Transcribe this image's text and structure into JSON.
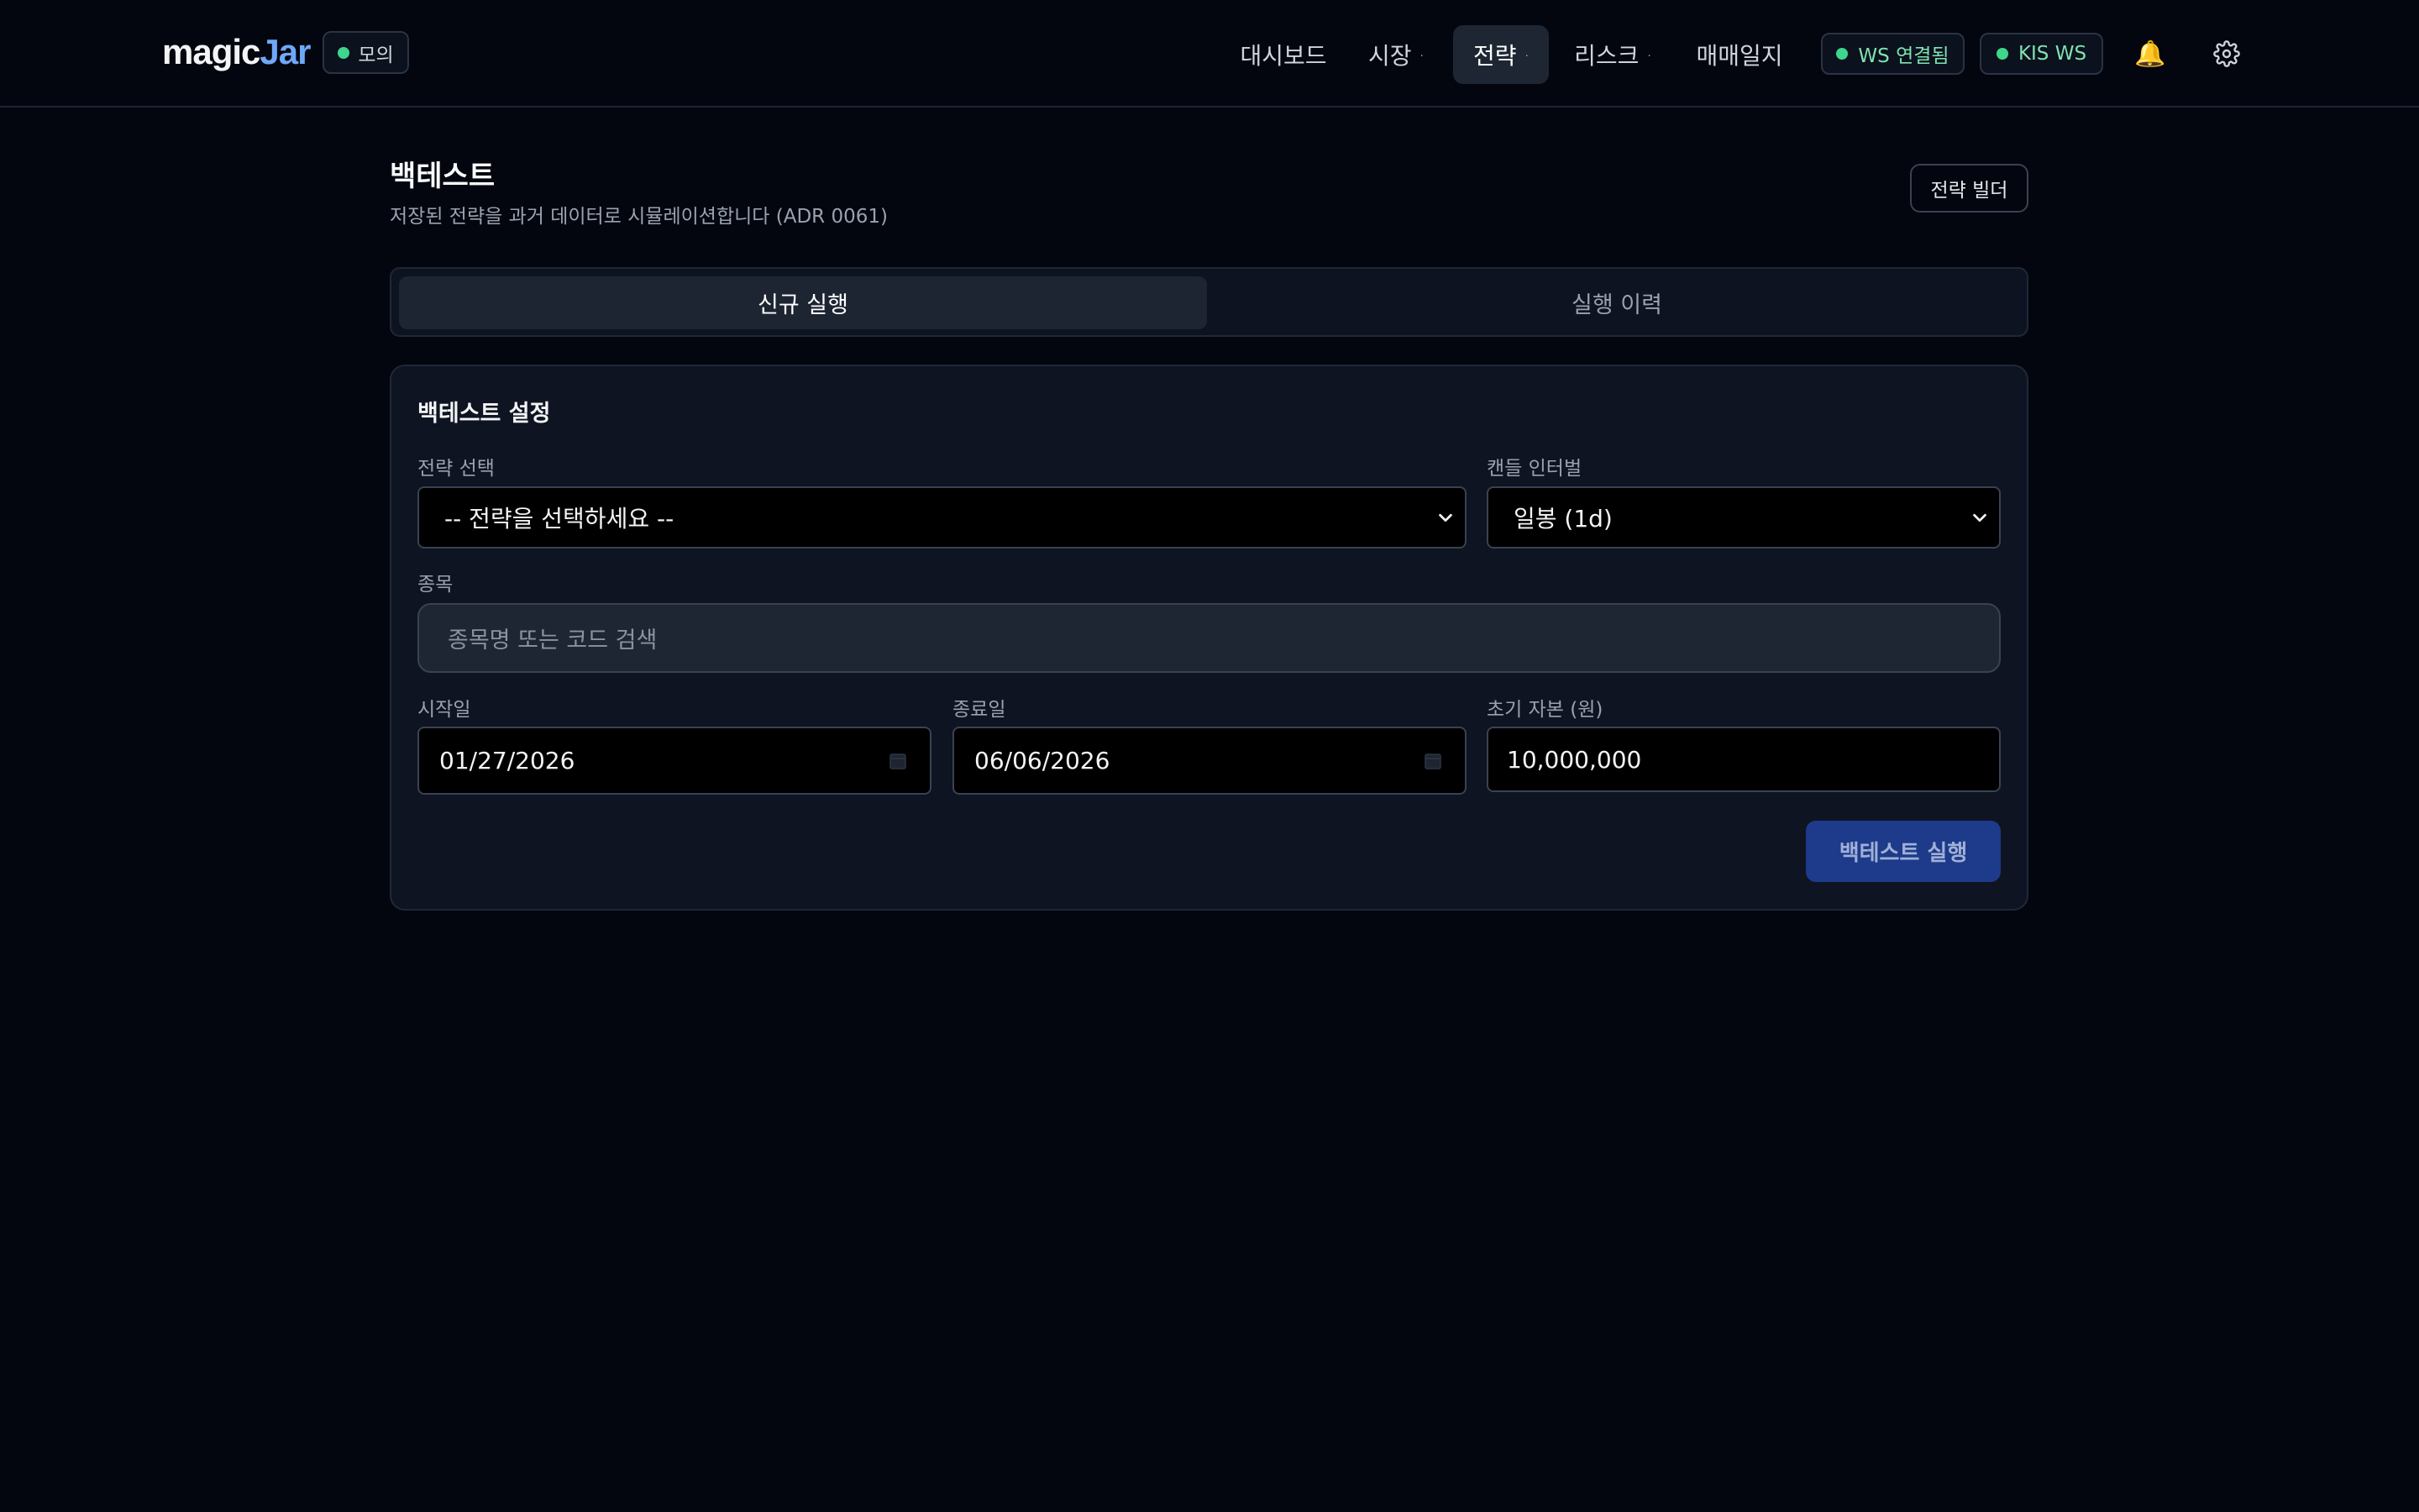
{
  "header": {
    "logo_main": "magic",
    "logo_accent": "Jar",
    "mode_badge": "모의",
    "nav": [
      {
        "label": "대시보드",
        "has_caret": false,
        "active": false
      },
      {
        "label": "시장",
        "has_caret": true,
        "active": false
      },
      {
        "label": "전략",
        "has_caret": true,
        "active": true
      },
      {
        "label": "리스크",
        "has_caret": true,
        "active": false
      },
      {
        "label": "매매일지",
        "has_caret": false,
        "active": false
      }
    ],
    "caret_glyph": "·",
    "ws_status": "WS 연결됨",
    "kis_status": "KIS WS",
    "status_color": "#3dd68c",
    "bell_icon": "🔔"
  },
  "page": {
    "title": "백테스트",
    "subtitle": "저장된 전략을 과거 데이터로 시뮬레이션합니다 (ADR 0061)",
    "builder_button": "전략 빌더"
  },
  "tabs": [
    {
      "label": "신규 실행",
      "active": true
    },
    {
      "label": "실행 이력",
      "active": false
    }
  ],
  "form": {
    "title": "백테스트 설정",
    "strategy_label": "전략 선택",
    "strategy_value": "-- 전략을 선택하세요 --",
    "interval_label": "캔들 인터벌",
    "interval_value": "일봉 (1d)",
    "symbol_label": "종목",
    "symbol_placeholder": "종목명 또는 코드 검색",
    "start_label": "시작일",
    "start_value": "01/27/2026",
    "end_label": "종료일",
    "end_value": "06/06/2026",
    "capital_label": "초기 자본 (원)",
    "capital_value": "10,000,000",
    "run_button": "백테스트 실행"
  },
  "colors": {
    "background": "#03060f",
    "accent": "#6ea8f7",
    "primary_button": "#1e3a8a"
  }
}
